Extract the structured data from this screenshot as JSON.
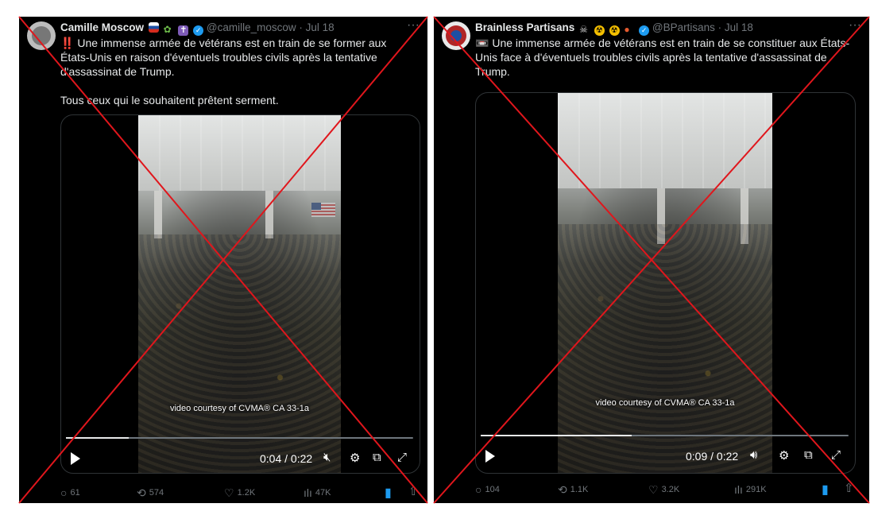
{
  "colors": {
    "background": "#000000",
    "text": "#e7e9ea",
    "muted": "#71767b",
    "accent": "#1d9bf0",
    "strike": "#e0161c"
  },
  "tweets": [
    {
      "display_name": "Camille Moscow",
      "handle_date": "@camille_moscow · Jul 18",
      "badges": [
        "flag-russia-icon",
        "plant-icon",
        "cross-icon",
        "verified-icon"
      ],
      "text_lead": "‼️",
      "text": "Une immense armée de vétérans est en train de se former aux États-Unis en raison d'éventuels troubles civils après la tentative d'assassinat de Trump.\n\nTous ceux qui le souhaitent prêtent serment.",
      "more": "···",
      "video": {
        "caption": "video courtesy of CVMA® CA 33-1a",
        "time": "0:04 / 0:22",
        "progress": 0.18
      },
      "stats": {
        "replies": "61",
        "reposts": "574",
        "likes": "1.2K",
        "views": "47K"
      }
    },
    {
      "display_name": "Brainless Partisans",
      "handle_date": "@BPartisans · Jul 18",
      "badges": [
        "pirate-flag-icon",
        "radioactive-icon",
        "radioactive-icon",
        "bomb-icon",
        "verified-icon"
      ],
      "text_lead": "📼",
      "text": "Une immense armée de vétérans est en train de se constituer aux États-Unis face à d'éventuels troubles civils après la tentative d'assassinat de Trump.",
      "more": "···",
      "video": {
        "caption": "video courtesy of CVMA® CA 33-1a",
        "time": "0:09 / 0:22",
        "progress": 0.41
      },
      "stats": {
        "replies": "104",
        "reposts": "1.1K",
        "likes": "3.2K",
        "views": "291K"
      }
    }
  ]
}
